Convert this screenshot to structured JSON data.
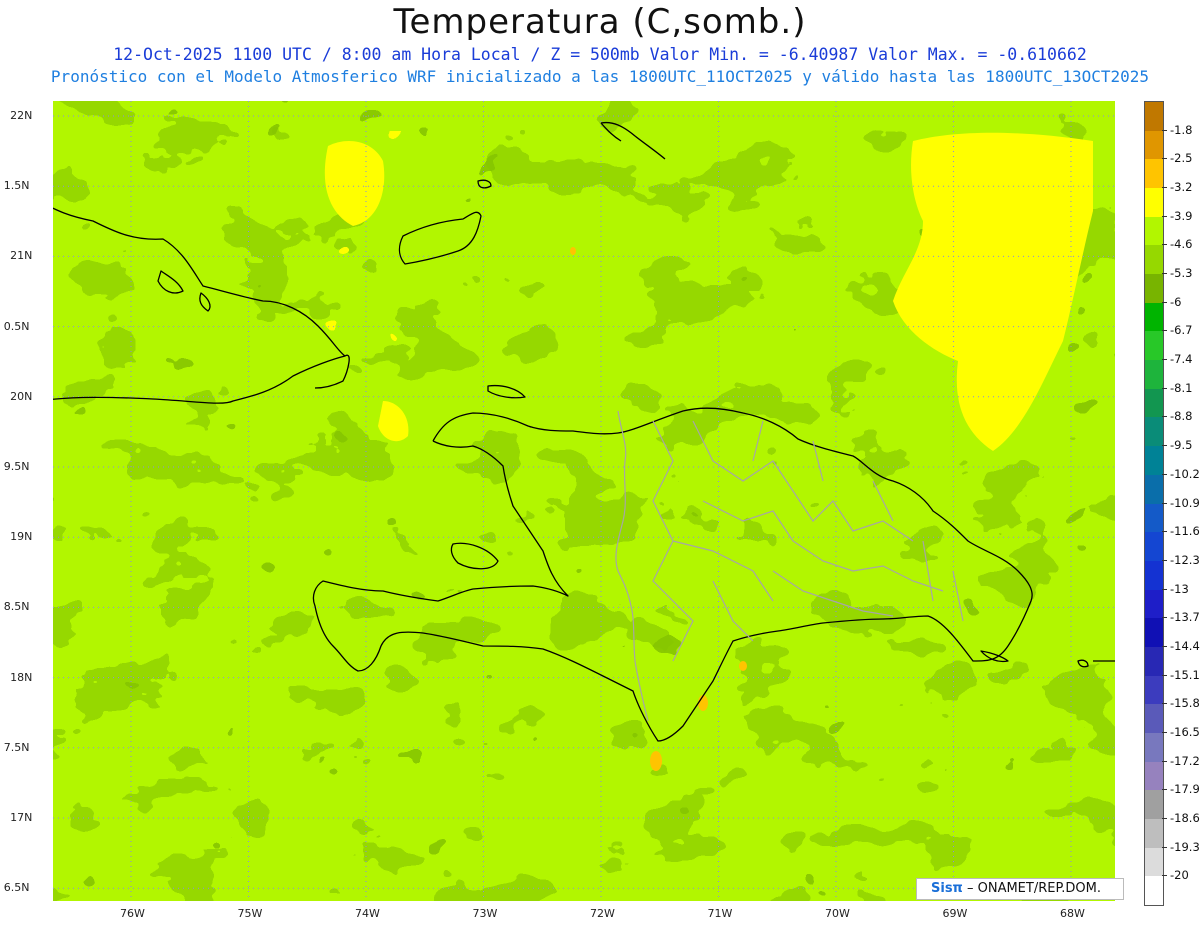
{
  "title": "Temperatura (C,somb.)",
  "subtitle1": "12-Oct-2025  1100 UTC / 8:00 am Hora Local / Z = 500mb  Valor Min. = -6.40987  Valor Max. = -0.610662",
  "subtitle2": "Pronóstico con el Modelo Atmosferico WRF inicializado a las 1800UTC_11OCT2025 y válido hasta las  1800UTC_13OCT2025",
  "lat_labels": [
    "22N",
    "1.5N",
    "21N",
    "0.5N",
    "20N",
    "9.5N",
    "19N",
    "8.5N",
    "18N",
    "7.5N",
    "17N",
    "6.5N"
  ],
  "lon_labels": [
    "76W",
    "75W",
    "74W",
    "73W",
    "72W",
    "71W",
    "70W",
    "69W",
    "68W"
  ],
  "colorbar": {
    "labels": [
      "-1.8",
      "-2.5",
      "-3.2",
      "-3.9",
      "-4.6",
      "-5.3",
      "-6",
      "-6.7",
      "-7.4",
      "-8.1",
      "-8.8",
      "-9.5",
      "-10.2",
      "-10.9",
      "-11.6",
      "-12.3",
      "-13",
      "-13.7",
      "-14.4",
      "-15.1",
      "-15.8",
      "-16.5",
      "-17.2",
      "-17.9",
      "-18.6",
      "-19.3",
      "-20"
    ],
    "colors": [
      "#c07800",
      "#e09600",
      "#ffc400",
      "#ffff00",
      "#b2f600",
      "#96d800",
      "#78b400",
      "#00b400",
      "#28c828",
      "#1eb43c",
      "#129650",
      "#0a8c78",
      "#008296",
      "#0a6eaa",
      "#145ac8",
      "#1446d2",
      "#1432d2",
      "#1e1ec8",
      "#1010b4",
      "#2828b4",
      "#3c3cbe",
      "#5a5ab9",
      "#7878be",
      "#9682be",
      "#a0a0a0",
      "#bebebe",
      "#dcdcdc",
      "#ffffff"
    ]
  },
  "credit": {
    "logo": "Sisπ",
    "text": " – ONAMET/REP.DOM."
  },
  "map_colors": {
    "base": "#b2f600",
    "mid": "#96d800",
    "dark": "#78b400",
    "warm": "#ffff00",
    "hot": "#ffc400",
    "coast": "#000000",
    "province": "#a6a6a6",
    "grid": "#8a8ae6"
  }
}
